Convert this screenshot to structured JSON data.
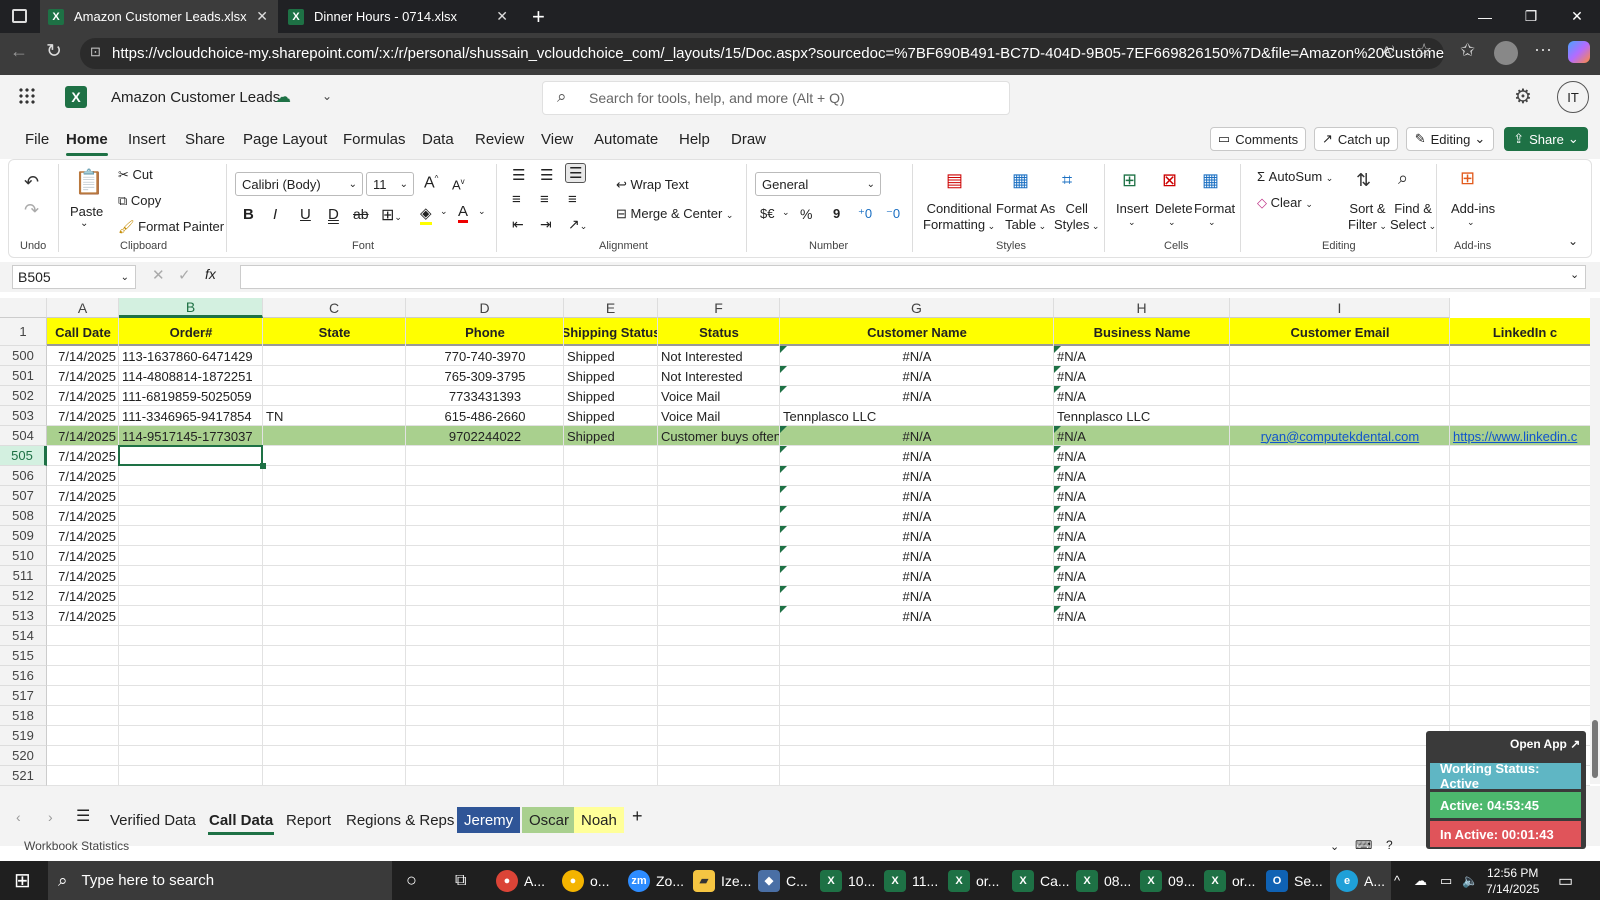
{
  "browser": {
    "tabs": [
      {
        "label": "Amazon Customer Leads.xlsx"
      },
      {
        "label": "Dinner Hours - 0714.xlsx"
      }
    ],
    "url": "https://vcloudchoice-my.sharepoint.com/:x:/r/personal/shussain_vcloudchoice_com/_layouts/15/Doc.aspx?sourcedoc=%7BF690B491-BC7D-404D-9B05-7EF669826150%7D&file=Amazon%20Customer%2..."
  },
  "app": {
    "title": "Amazon Customer Leads",
    "search_placeholder": "Search for tools, help, and more (Alt + Q)",
    "avatar": "IT"
  },
  "menu": [
    "File",
    "Home",
    "Insert",
    "Share",
    "Page Layout",
    "Formulas",
    "Data",
    "Review",
    "View",
    "Automate",
    "Help",
    "Draw"
  ],
  "header_buttons": {
    "comments": "Comments",
    "catchup": "Catch up",
    "editing": "Editing",
    "share": "Share"
  },
  "ribbon": {
    "undo": "Undo",
    "paste": "Paste",
    "cut": "Cut",
    "copy": "Copy",
    "format_painter": "Format Painter",
    "clipboard": "Clipboard",
    "font_name": "Calibri (Body)",
    "font_size": "11",
    "font": "Font",
    "bold": "B",
    "italic": "I",
    "underline": "U",
    "double_underline": "D",
    "strike": "ab",
    "wrap_text": "Wrap Text",
    "merge_center": "Merge & Center",
    "alignment": "Alignment",
    "number_format": "General",
    "currency": "$€",
    "percent": "%",
    "comma": "9",
    "number": "Number",
    "cond_format": [
      "Conditional",
      "Formatting"
    ],
    "format_table": [
      "Format As",
      "Table"
    ],
    "cell_styles": [
      "Cell",
      "Styles"
    ],
    "styles": "Styles",
    "insert": "Insert",
    "delete": "Delete",
    "format": "Format",
    "cells": "Cells",
    "autosum": "AutoSum",
    "clear": "Clear",
    "sort_filter": [
      "Sort &",
      "Filter"
    ],
    "find_select": [
      "Find &",
      "Select"
    ],
    "editing": "Editing",
    "addins": "Add-ins",
    "addins_group": "Add-ins"
  },
  "formula": {
    "namebox": "B505",
    "fx": "fx"
  },
  "columns": [
    "A",
    "B",
    "C",
    "D",
    "E",
    "F",
    "G",
    "H",
    "I"
  ],
  "header_row": {
    "num": "1",
    "cells": [
      "Call Date",
      "Order#",
      "State",
      "Phone",
      "Shipping Status",
      "Status",
      "Customer Name",
      "Business Name",
      "Customer Email",
      "LinkedIn c"
    ]
  },
  "rows": [
    {
      "num": "500",
      "a": "7/14/2025",
      "b": "113-1637860-6471429",
      "c": "",
      "d": "770-740-3970",
      "e": "Shipped",
      "f": "Not Interested",
      "g": "#N/A",
      "h": "#N/A",
      "i": "",
      "j": ""
    },
    {
      "num": "501",
      "a": "7/14/2025",
      "b": "114-4808814-1872251",
      "c": "",
      "d": "765-309-3795",
      "e": "Shipped",
      "f": "Not Interested",
      "g": "#N/A",
      "h": "#N/A",
      "i": "",
      "j": ""
    },
    {
      "num": "502",
      "a": "7/14/2025",
      "b": "111-6819859-5025059",
      "c": "",
      "d": "7733431393",
      "e": "Shipped",
      "f": "Voice Mail",
      "g": "#N/A",
      "h": "#N/A",
      "i": "",
      "j": ""
    },
    {
      "num": "503",
      "a": "7/14/2025",
      "b": "111-3346965-9417854",
      "c": "TN",
      "d": "615-486-2660",
      "e": "Shipped",
      "f": "Voice Mail",
      "g": "Tennplasco LLC",
      "h": "Tennplasco LLC",
      "i": "",
      "j": ""
    },
    {
      "num": "504",
      "a": "7/14/2025",
      "b": "114-9517145-1773037",
      "c": "",
      "d": "9702244022",
      "e": "Shipped",
      "f": "Customer buys often",
      "g": "#N/A",
      "h": "#N/A",
      "i": "ryan@computekdental.com",
      "j": "https://www.linkedin.c"
    },
    {
      "num": "505",
      "a": "7/14/2025",
      "b": "",
      "c": "",
      "d": "",
      "e": "",
      "f": "",
      "g": "#N/A",
      "h": "#N/A",
      "i": "",
      "j": ""
    },
    {
      "num": "506",
      "a": "7/14/2025",
      "b": "",
      "c": "",
      "d": "",
      "e": "",
      "f": "",
      "g": "#N/A",
      "h": "#N/A",
      "i": "",
      "j": ""
    },
    {
      "num": "507",
      "a": "7/14/2025",
      "b": "",
      "c": "",
      "d": "",
      "e": "",
      "f": "",
      "g": "#N/A",
      "h": "#N/A",
      "i": "",
      "j": ""
    },
    {
      "num": "508",
      "a": "7/14/2025",
      "b": "",
      "c": "",
      "d": "",
      "e": "",
      "f": "",
      "g": "#N/A",
      "h": "#N/A",
      "i": "",
      "j": ""
    },
    {
      "num": "509",
      "a": "7/14/2025",
      "b": "",
      "c": "",
      "d": "",
      "e": "",
      "f": "",
      "g": "#N/A",
      "h": "#N/A",
      "i": "",
      "j": ""
    },
    {
      "num": "510",
      "a": "7/14/2025",
      "b": "",
      "c": "",
      "d": "",
      "e": "",
      "f": "",
      "g": "#N/A",
      "h": "#N/A",
      "i": "",
      "j": ""
    },
    {
      "num": "511",
      "a": "7/14/2025",
      "b": "",
      "c": "",
      "d": "",
      "e": "",
      "f": "",
      "g": "#N/A",
      "h": "#N/A",
      "i": "",
      "j": ""
    },
    {
      "num": "512",
      "a": "7/14/2025",
      "b": "",
      "c": "",
      "d": "",
      "e": "",
      "f": "",
      "g": "#N/A",
      "h": "#N/A",
      "i": "",
      "j": ""
    },
    {
      "num": "513",
      "a": "7/14/2025",
      "b": "",
      "c": "",
      "d": "",
      "e": "",
      "f": "",
      "g": "#N/A",
      "h": "#N/A",
      "i": "",
      "j": ""
    },
    {
      "num": "514",
      "a": "",
      "b": "",
      "c": "",
      "d": "",
      "e": "",
      "f": "",
      "g": "",
      "h": "",
      "i": "",
      "j": ""
    },
    {
      "num": "515",
      "a": "",
      "b": "",
      "c": "",
      "d": "",
      "e": "",
      "f": "",
      "g": "",
      "h": "",
      "i": "",
      "j": ""
    },
    {
      "num": "516",
      "a": "",
      "b": "",
      "c": "",
      "d": "",
      "e": "",
      "f": "",
      "g": "",
      "h": "",
      "i": "",
      "j": ""
    },
    {
      "num": "517",
      "a": "",
      "b": "",
      "c": "",
      "d": "",
      "e": "",
      "f": "",
      "g": "",
      "h": "",
      "i": "",
      "j": ""
    },
    {
      "num": "518",
      "a": "",
      "b": "",
      "c": "",
      "d": "",
      "e": "",
      "f": "",
      "g": "",
      "h": "",
      "i": "",
      "j": ""
    },
    {
      "num": "519",
      "a": "",
      "b": "",
      "c": "",
      "d": "",
      "e": "",
      "f": "",
      "g": "",
      "h": "",
      "i": "",
      "j": ""
    },
    {
      "num": "520",
      "a": "",
      "b": "",
      "c": "",
      "d": "",
      "e": "",
      "f": "",
      "g": "",
      "h": "",
      "i": "",
      "j": ""
    },
    {
      "num": "521",
      "a": "",
      "b": "",
      "c": "",
      "d": "",
      "e": "",
      "f": "",
      "g": "",
      "h": "",
      "i": "",
      "j": ""
    }
  ],
  "sheets": [
    {
      "label": "Verified Data",
      "color": ""
    },
    {
      "label": "Call Data",
      "color": "",
      "active": true
    },
    {
      "label": "Report",
      "color": ""
    },
    {
      "label": "Regions & Reps",
      "color": ""
    },
    {
      "label": "Jeremy",
      "color": "#2f5597"
    },
    {
      "label": "Oscar",
      "color": "#a9d08e"
    },
    {
      "label": "Noah",
      "color": "#ffff99"
    }
  ],
  "status": {
    "left": "Workbook Statistics"
  },
  "widget": {
    "open_app": "Open App ↗",
    "working": "Working Status: Active",
    "active": "Active: 04:53:45",
    "inactive": "In Active: 00:01:43"
  },
  "taskbar": {
    "search": "Type here to search",
    "items": [
      "A...",
      "o...",
      "Zo...",
      "Ize...",
      "C...",
      "10...",
      "11...",
      "or...",
      "Ca...",
      "08...",
      "09...",
      "or...",
      "Se...",
      "A..."
    ],
    "time": "12:56 PM",
    "date": "7/14/2025"
  },
  "colors": {
    "header_yellow": "#ffff00",
    "highlight_green": "#a9d08e",
    "excel_green": "#1e7145"
  }
}
